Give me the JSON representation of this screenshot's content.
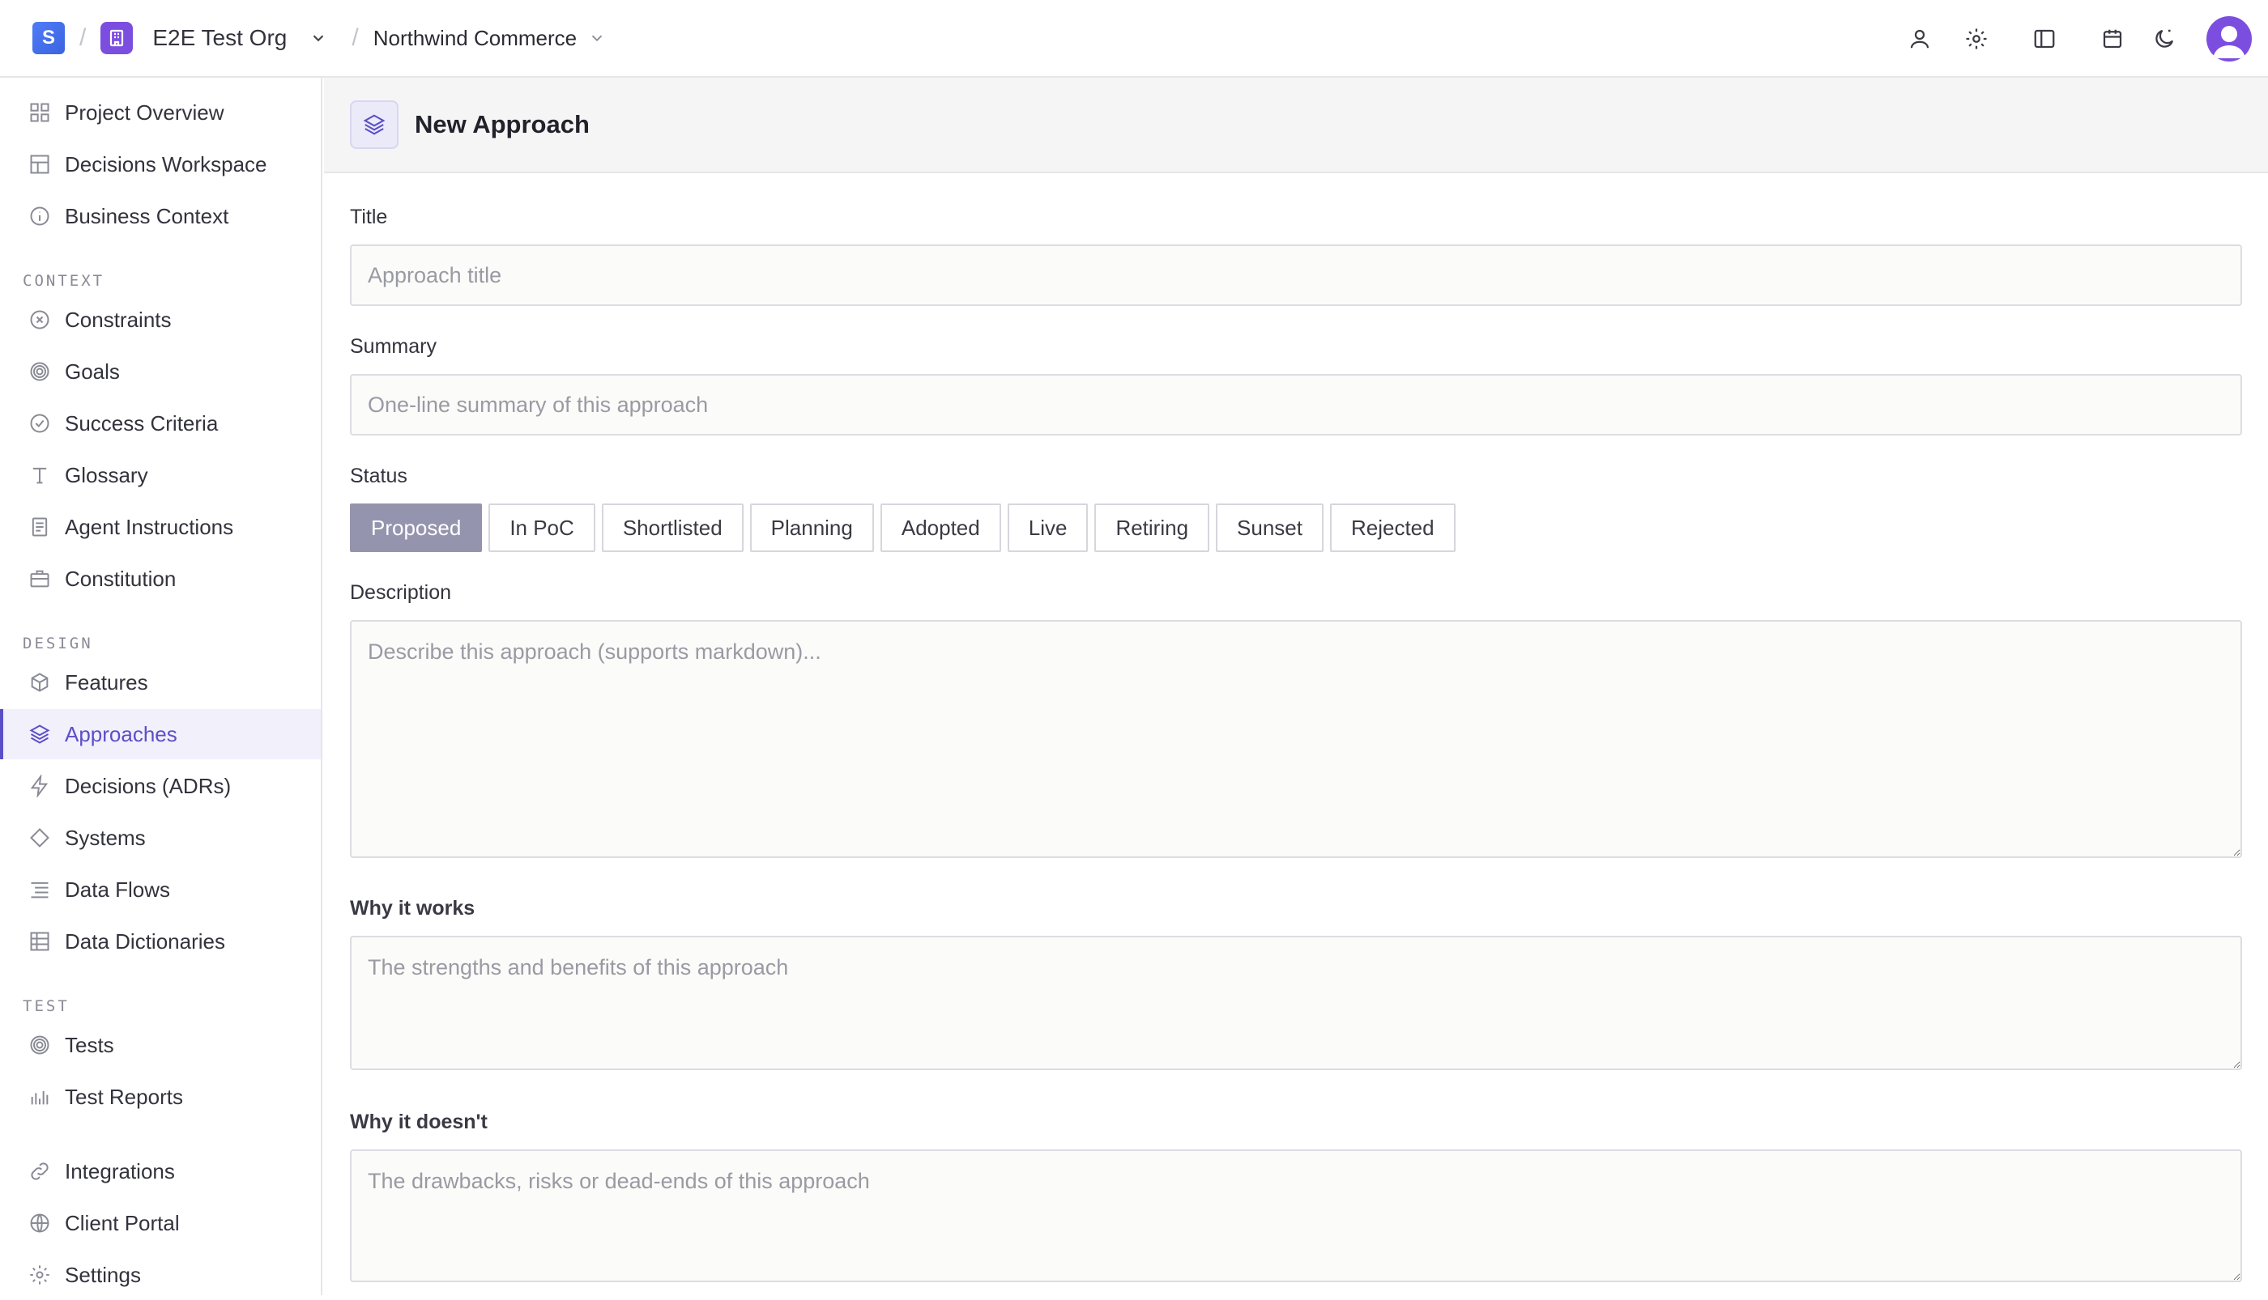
{
  "topbar": {
    "logo_letter": "S",
    "org_name": "E2E Test Org",
    "project_name": "Northwind Commerce",
    "icons": [
      "user-icon",
      "gear-icon",
      "sidebar-panel-icon",
      "calendar-icon",
      "theme-moon-icon"
    ]
  },
  "sidebar": {
    "top_items": [
      {
        "label": "Project Overview",
        "icon": "grid-icon"
      },
      {
        "label": "Decisions Workspace",
        "icon": "table-icon"
      },
      {
        "label": "Business Context",
        "icon": "info-icon"
      }
    ],
    "context_label": "CONTEXT",
    "context_items": [
      {
        "label": "Constraints",
        "icon": "x-circle-icon"
      },
      {
        "label": "Goals",
        "icon": "target-icon"
      },
      {
        "label": "Success Criteria",
        "icon": "check-circle-icon"
      },
      {
        "label": "Glossary",
        "icon": "type-icon"
      },
      {
        "label": "Agent Instructions",
        "icon": "file-text-icon"
      },
      {
        "label": "Constitution",
        "icon": "briefcase-icon"
      }
    ],
    "design_label": "DESIGN",
    "design_items": [
      {
        "label": "Features",
        "icon": "box-icon"
      },
      {
        "label": "Approaches",
        "icon": "layers-icon",
        "active": true
      },
      {
        "label": "Decisions (ADRs)",
        "icon": "zap-icon"
      },
      {
        "label": "Systems",
        "icon": "diamond-icon"
      },
      {
        "label": "Data Flows",
        "icon": "list-icon"
      },
      {
        "label": "Data Dictionaries",
        "icon": "table-icon"
      }
    ],
    "test_label": "TEST",
    "test_items": [
      {
        "label": "Tests",
        "icon": "target-icon"
      },
      {
        "label": "Test Reports",
        "icon": "bar-chart-icon"
      }
    ],
    "bottom_items": [
      {
        "label": "Integrations",
        "icon": "link-icon"
      },
      {
        "label": "Client Portal",
        "icon": "globe-icon"
      },
      {
        "label": "Settings",
        "icon": "gear-icon"
      }
    ]
  },
  "main": {
    "page_title": "New Approach",
    "title_label": "Title",
    "title_placeholder": "Approach title",
    "summary_label": "Summary",
    "summary_placeholder": "One-line summary of this approach",
    "status_label": "Status",
    "statuses": [
      "Proposed",
      "In PoC",
      "Shortlisted",
      "Planning",
      "Adopted",
      "Live",
      "Retiring",
      "Sunset",
      "Rejected"
    ],
    "selected_status": "Proposed",
    "description_label": "Description",
    "description_placeholder": "Describe this approach (supports markdown)...",
    "why_works_label": "Why it works",
    "why_works_placeholder": "The strengths and benefits of this approach",
    "why_not_label": "Why it doesn't",
    "why_not_placeholder": "The drawbacks, risks or dead-ends of this approach"
  },
  "colors": {
    "accent": "#5b4fc7",
    "org_purple": "#7c4ee0",
    "logo_blue": "#4f7cf7",
    "selected_status_bg": "#9594ae"
  }
}
